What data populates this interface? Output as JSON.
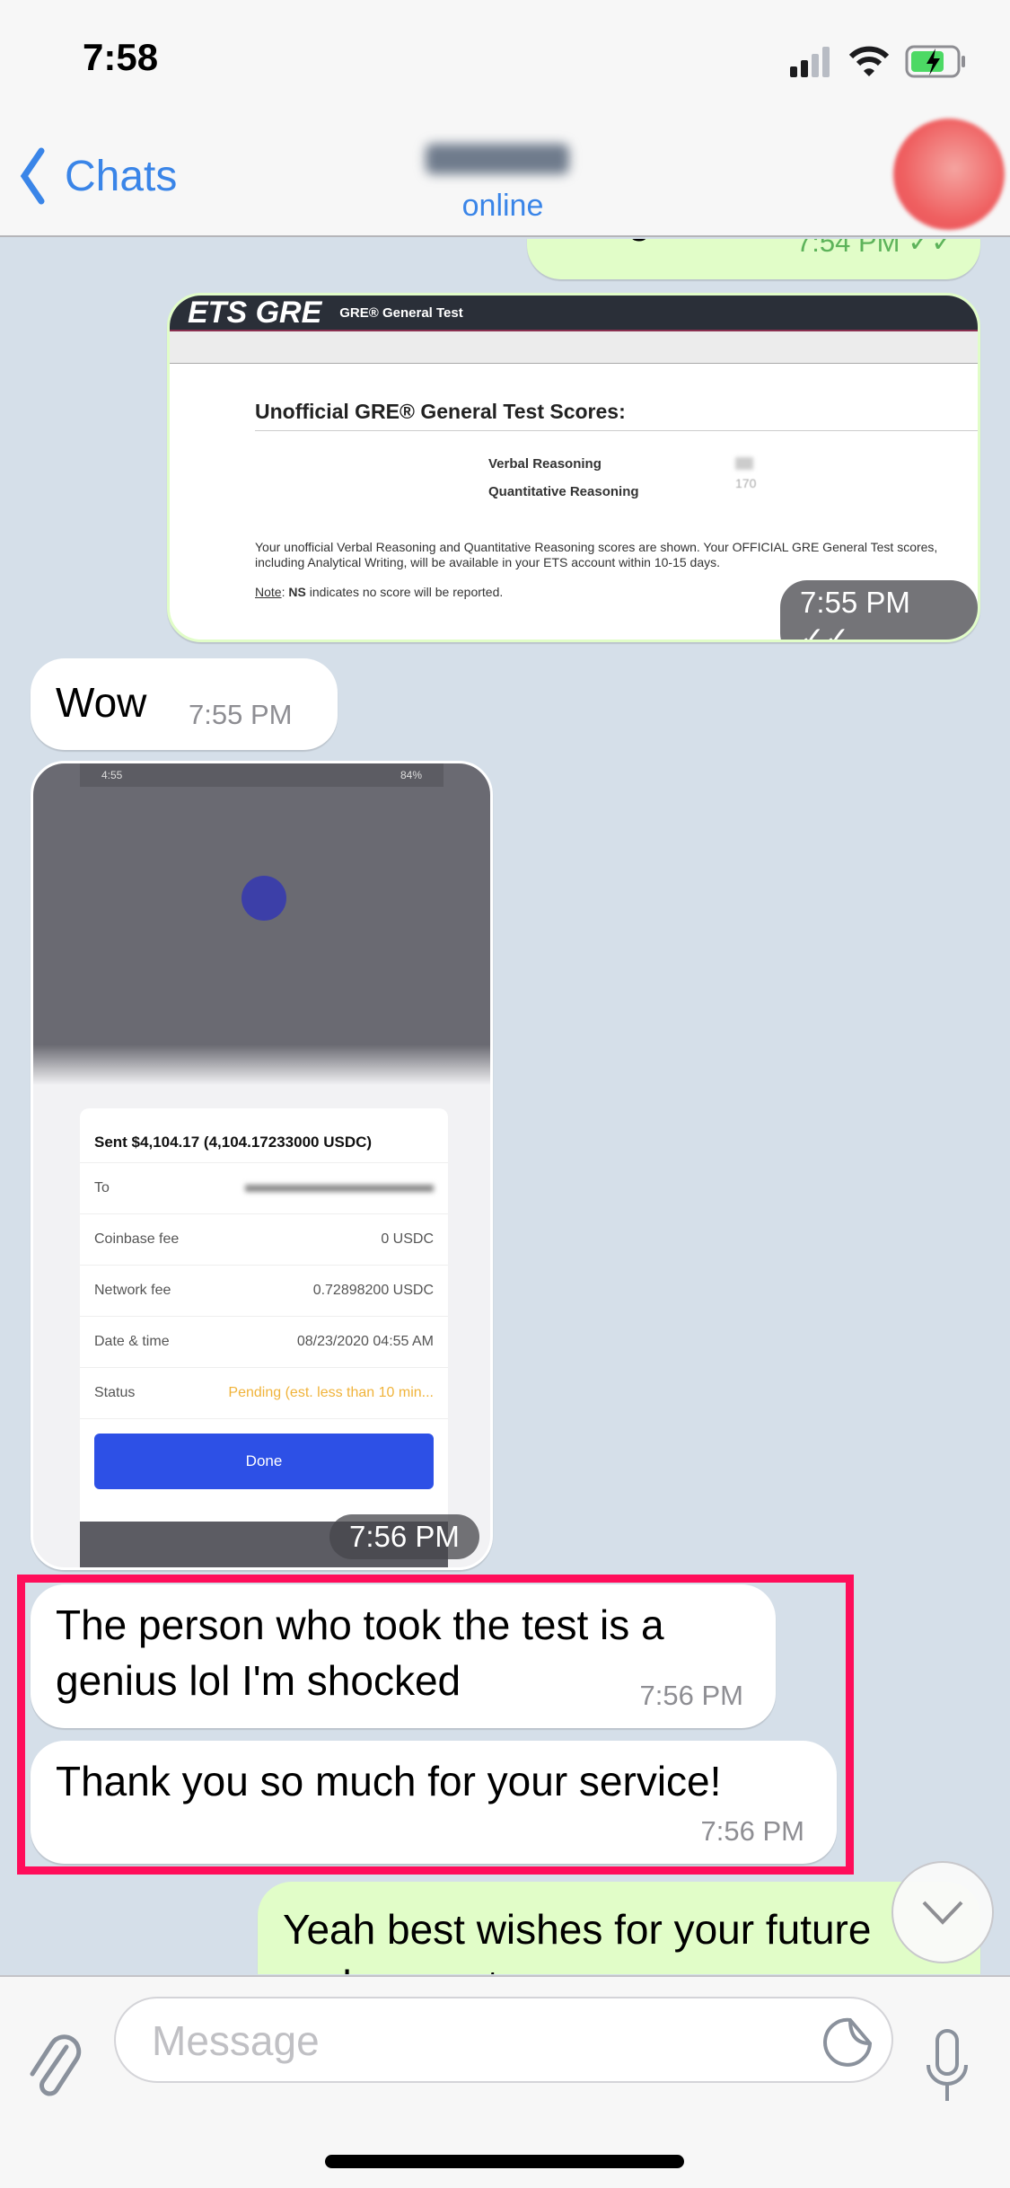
{
  "status_bar": {
    "time": "7:58",
    "battery": "charging"
  },
  "nav": {
    "back_label": "Chats",
    "contact_status": "online"
  },
  "messages": [
    {
      "dir": "out",
      "text": "Congrats",
      "time": "7:54 PM",
      "read": true
    },
    {
      "dir": "out",
      "type": "image",
      "time": "7:55 PM",
      "read": true,
      "image": {
        "header_logo": "ETS GRE",
        "header_title": "GRE® General Test",
        "heading": "Unofficial GRE® General Test Scores:",
        "scores": [
          {
            "label": "Verbal Reasoning",
            "value": ""
          },
          {
            "label": "Quantitative Reasoning",
            "value": "170"
          }
        ],
        "body": "Your unofficial Verbal Reasoning and Quantitative Reasoning scores are shown. Your OFFICIAL GRE General Test scores, including Analytical Writing, will be available in your ETS account within 10-15 days.",
        "note_label": "Note",
        "note_bold": "NS",
        "note_text": " indicates no score will be reported."
      }
    },
    {
      "dir": "in",
      "text": "Wow",
      "time": "7:55 PM"
    },
    {
      "dir": "in",
      "type": "image",
      "time": "7:56 PM",
      "image": {
        "phone_time": "4:55",
        "phone_battery": "84%",
        "title": "Sent $4,104.17 (4,104.17233000 USDC)",
        "rows": [
          {
            "label": "To",
            "value": ""
          },
          {
            "label": "Coinbase fee",
            "value": "0 USDC"
          },
          {
            "label": "Network fee",
            "value": "0.72898200 USDC"
          },
          {
            "label": "Date & time",
            "value": "08/23/2020 04:55 AM"
          },
          {
            "label": "Status",
            "value": "Pending (est. less than 10 min..."
          }
        ],
        "button": "Done",
        "status_color": "#f0b33a",
        "button_color": "#2d50e6"
      }
    },
    {
      "dir": "in",
      "text": "The person who took the test is a genius lol I'm shocked",
      "time": "7:56 PM"
    },
    {
      "dir": "in",
      "text": "Thank you so much for your service!",
      "time": "7:56 PM"
    },
    {
      "dir": "out",
      "text": "Yeah best wishes for your future endeavors too"
    }
  ],
  "input": {
    "placeholder": "Message"
  },
  "colors": {
    "accent": "#3a85e8",
    "highlight_box": "#ff0d5a",
    "outgoing": "#e1fdc8"
  }
}
